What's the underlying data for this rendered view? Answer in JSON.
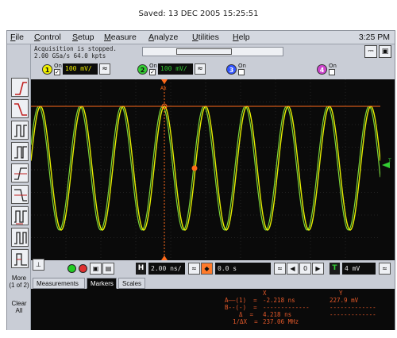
{
  "header": {
    "saved_text": "Saved:  13 DEC 2005  15:25:51"
  },
  "menu": {
    "items": [
      "File",
      "Control",
      "Setup",
      "Measure",
      "Analyze",
      "Utilities",
      "Help"
    ],
    "clock": "3:25 PM"
  },
  "status": {
    "line1": "Acquisition is stopped.",
    "line2": "2.00 GSa/s   64.0 kpts"
  },
  "channels": [
    {
      "number": "1",
      "on_label": "On",
      "checked": true,
      "scale": "100 mV/",
      "color": "#f0f000"
    },
    {
      "number": "2",
      "on_label": "On",
      "checked": true,
      "scale": "100 mV/",
      "color": "#33cc33"
    },
    {
      "number": "3",
      "on_label": "On",
      "checked": false,
      "color": "#3355ff"
    },
    {
      "number": "4",
      "on_label": "On",
      "checked": false,
      "color": "#cc44cc"
    }
  ],
  "sidebar": {
    "more_label": "More",
    "more_sub": "(1 of 2)",
    "clear_label": "Clear",
    "clear_sub": "All"
  },
  "controls": {
    "h_label": "H",
    "timebase": "2.00 ns/",
    "delay": "0.0 s",
    "t_label": "T",
    "trigger_level": "4 mV",
    "run_color": "#22cc22",
    "stop_color": "#e03030"
  },
  "tabs": [
    "Measurements",
    "Markers",
    "Scales"
  ],
  "active_tab": "Markers",
  "markers": {
    "col_x": "X",
    "col_y": "Y",
    "row_a_label": "A——(1)  =",
    "row_a_x": "-2.218 ns",
    "row_a_y": "227.9 mV",
    "row_b_label": "B--(-)  =",
    "row_b_x": "-------------",
    "row_b_y": "-------------",
    "row_delta_label": "Δ  =",
    "row_delta_x": "4.218 ns",
    "row_delta_y": "-------------",
    "row_inv_label": "1/ΔX  =",
    "row_inv_x": "237.06 MHz"
  },
  "display": {
    "trace_color": "#e8f000",
    "trace2_color": "#7ad63a",
    "marker_color": "#ff6a1a",
    "grid_color": "#3a3a3a",
    "marker_a_label": "Ax",
    "ref_label": "T"
  }
}
